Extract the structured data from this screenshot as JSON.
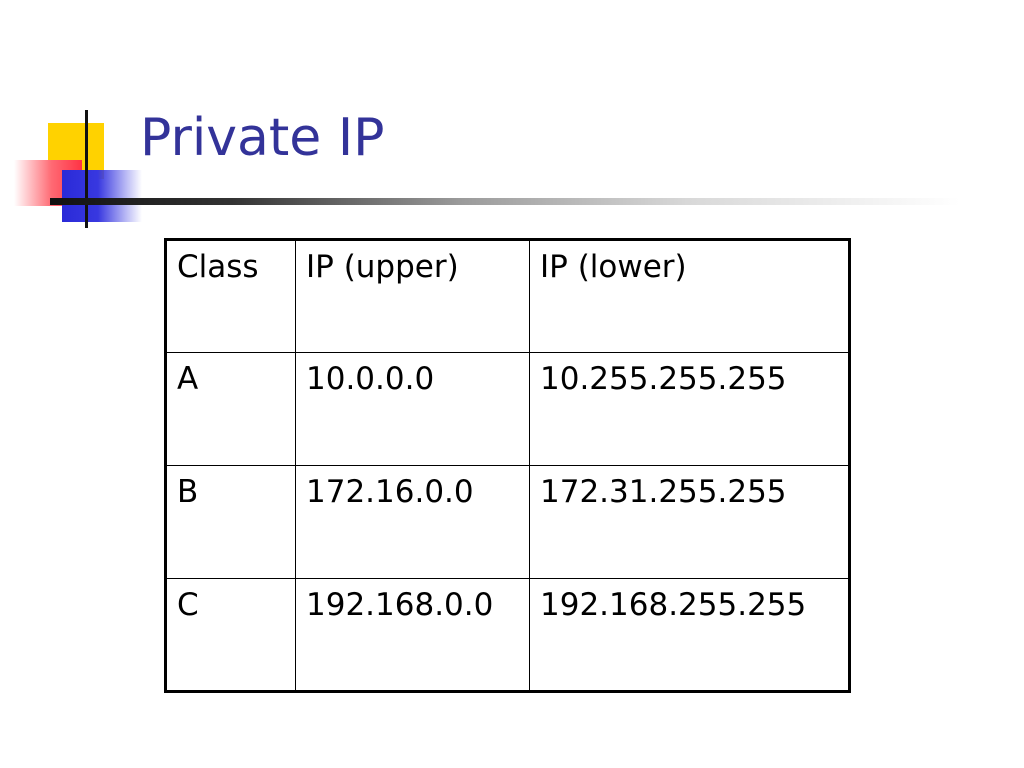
{
  "slide": {
    "title": "Private IP"
  },
  "table": {
    "headers": [
      "Class",
      "IP (upper)",
      "IP (lower)"
    ],
    "rows": [
      [
        "A",
        "10.0.0.0",
        "10.255.255.255"
      ],
      [
        "B",
        "172.16.0.0",
        "172.31.255.255"
      ],
      [
        "C",
        "192.168.0.0",
        "192.168.255.255"
      ]
    ]
  },
  "colors": {
    "title": "#333399",
    "accent_yellow": "#ffd200",
    "accent_red": "#ff3344",
    "accent_blue": "#2a2ad8"
  }
}
